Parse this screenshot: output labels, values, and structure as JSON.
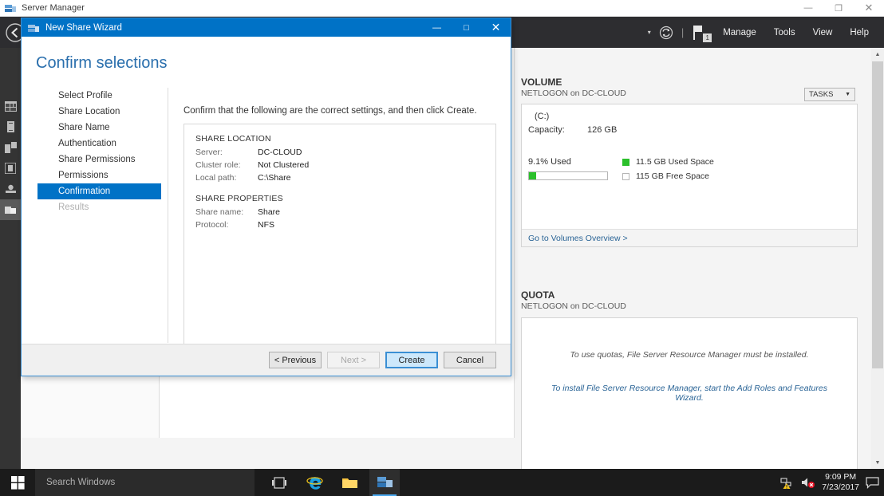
{
  "main_window": {
    "title": "Server Manager",
    "icon": "server-manager-icon",
    "controls": {
      "minimize": "—",
      "restore": "❐",
      "close": "✕"
    }
  },
  "header": {
    "back_icon": "back-arrow-icon",
    "dropdown_caret": "▾",
    "refresh_icon": "refresh-icon",
    "separator": "|",
    "flag_icon": "notification-flag-icon",
    "flag_badge": "1",
    "menu": [
      {
        "label": "Manage"
      },
      {
        "label": "Tools"
      },
      {
        "label": "View"
      },
      {
        "label": "Help"
      }
    ]
  },
  "rail": {
    "items": [
      {
        "name": "dashboard-icon"
      },
      {
        "name": "local-server-icon"
      },
      {
        "name": "all-servers-icon"
      },
      {
        "name": "ad-ds-icon"
      },
      {
        "name": "dns-icon"
      },
      {
        "name": "file-services-icon"
      }
    ]
  },
  "volume_panel": {
    "title": "VOLUME",
    "subtitle": "NETLOGON on DC-CLOUD",
    "tasks_label": "TASKS",
    "tasks_caret": "▼",
    "drive": "(C:)",
    "capacity_label": "Capacity:",
    "capacity_value": "126 GB",
    "used_percent_label": "9.1% Used",
    "used_percent": 9.1,
    "legend": [
      {
        "swatch": "#2bc02b",
        "filled": true,
        "text": "11.5 GB Used Space"
      },
      {
        "swatch": "#ffffff",
        "filled": false,
        "text": "115 GB Free Space"
      }
    ],
    "overview_link": "Go to Volumes Overview >"
  },
  "quota_panel": {
    "title": "QUOTA",
    "subtitle": "NETLOGON on DC-CLOUD",
    "message": "To use quotas, File Server Resource Manager must be installed.",
    "link": "To install File Server Resource Manager, start the Add Roles and Features Wizard."
  },
  "scrollbar": {
    "up_arrow": "▲",
    "down_arrow": "▼"
  },
  "wizard": {
    "title": "New Share Wizard",
    "icon": "share-wizard-icon",
    "controls": {
      "minimize": "—",
      "maximize": "□",
      "close": "✕"
    },
    "heading": "Confirm selections",
    "nav": [
      {
        "label": "Select Profile",
        "state": "normal"
      },
      {
        "label": "Share Location",
        "state": "normal"
      },
      {
        "label": "Share Name",
        "state": "normal"
      },
      {
        "label": "Authentication",
        "state": "normal"
      },
      {
        "label": "Share Permissions",
        "state": "normal"
      },
      {
        "label": "Permissions",
        "state": "normal"
      },
      {
        "label": "Confirmation",
        "state": "active"
      },
      {
        "label": "Results",
        "state": "disabled"
      }
    ],
    "instruction": "Confirm that the following are the correct settings, and then click Create.",
    "sections": [
      {
        "heading": "SHARE LOCATION",
        "rows": [
          {
            "key": "Server:",
            "value": "DC-CLOUD"
          },
          {
            "key": "Cluster role:",
            "value": "Not Clustered"
          },
          {
            "key": "Local path:",
            "value": "C:\\Share"
          }
        ]
      },
      {
        "heading": "SHARE PROPERTIES",
        "rows": [
          {
            "key": "Share name:",
            "value": "Share"
          },
          {
            "key": "Protocol:",
            "value": "NFS"
          }
        ]
      }
    ],
    "buttons": [
      {
        "label": "< Previous",
        "style": "normal"
      },
      {
        "label": "Next >",
        "style": "disabled"
      },
      {
        "label": "Create",
        "style": "primary"
      },
      {
        "label": "Cancel",
        "style": "normal"
      }
    ]
  },
  "taskbar": {
    "start_icon": "windows-start-icon",
    "search_placeholder": "Search Windows",
    "icons": [
      {
        "name": "task-view-icon",
        "active": false
      },
      {
        "name": "internet-explorer-icon",
        "active": false
      },
      {
        "name": "file-explorer-icon",
        "active": false
      },
      {
        "name": "server-manager-taskbar-icon",
        "active": true
      }
    ],
    "tray": {
      "network_icon": "network-warning-icon",
      "volume_icon": "volume-muted-icon",
      "time": "9:09 PM",
      "date": "7/23/2017",
      "action_center_icon": "action-center-icon"
    }
  },
  "colors": {
    "accent": "#0072c6",
    "heading": "#2a6fad",
    "green": "#2bc02b",
    "link": "#2a6496"
  }
}
